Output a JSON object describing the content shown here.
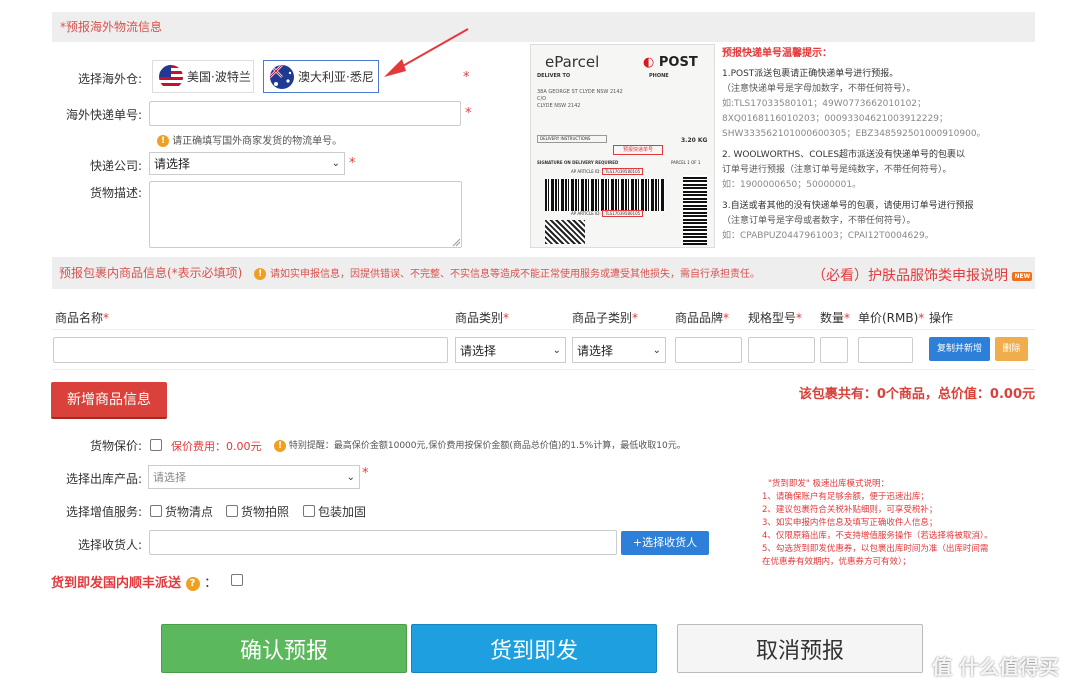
{
  "logistics": {
    "section_title": "*预报海外物流信息",
    "warehouse_label": "选择海外仓:",
    "warehouse_options": [
      {
        "label": "美国·波特兰"
      },
      {
        "label": "澳大利亚·悉尼"
      }
    ],
    "tracking_label": "海外快递单号:",
    "tracking_value": "",
    "tracking_hint": "请正确填写国外商家发货的物流单号。",
    "courier_label": "快递公司:",
    "courier_value": "请选择",
    "desc_label": "货物描述:",
    "desc_value": "",
    "required_mark": "*"
  },
  "parcel_image": {
    "brand": "eParcel",
    "carrier": "POST",
    "deliver_to": "DELIVER TO",
    "phone": "PHONE",
    "address_lines": [
      "38A GEORGE ST CLYDE NSW 2142",
      "C/O",
      "CLYDE NSW 2142"
    ],
    "delivery_instructions": "DELIVERY INSTRUCTIONS",
    "weight": "3.20 KG",
    "signature": "SIGNATURE ON DELIVERY REQUIRED",
    "parcel": "PARCEL 1 OF 1",
    "article_id_label": "AP ARTICLE ID:",
    "article_id": "TLS17039580105",
    "annotation": "预报快递单号"
  },
  "tracking_tips": {
    "title": "预报快递单号温馨提示：",
    "lines": [
      "1.POST派送包裹请正确快递单号进行预报。",
      "（注意快递单号是字母加数字，不带任何符号）。",
      "如:TLS17033580101；49W0773662010102；",
      "8XQ0168116010203；00093304621003912229；",
      "SHW333562101000600305；EBZ348592501000910900。",
      "2. WOOLWORTHS、COLES超市派送没有快递单号的包裹以",
      "订单号进行预报（注意订单号是纯数字，不带任何符号）。",
      "如：1900000650；50000001。",
      "3.自送或者其他的没有快递单号的包裹，请使用订单号进行预报",
      "（注意订单号是字母或者数字，不带任何符号）。",
      "如：CPABPUZ0447961003；CPAI12T0004629。"
    ]
  },
  "goods": {
    "section_title": "预报包裹内商品信息(*表示必填项)",
    "warning": "请如实申报信息，因提供错误、不完整、不实信息等造成不能正常使用服务或遭受其他损失，需自行承担责任。",
    "notice_link": "（必看）护肤品服饰类申报说明",
    "new_badge": "NEW",
    "columns": {
      "name": "商品名称",
      "category": "商品类别",
      "subcategory": "商品子类别",
      "brand": "商品品牌",
      "spec": "规格型号",
      "qty": "数量",
      "price": "单价(RMB)",
      "action": "操作"
    },
    "row": {
      "category_value": "请选择",
      "subcategory_value": "请选择",
      "copy_button": "复制并新增",
      "delete_button": "删除"
    },
    "add_button": "新增商品信息",
    "summary": "该包裹共有：0个商品，总价值：0.00元"
  },
  "options": {
    "insurance_label": "货物保价:",
    "insurance_fee": "保价费用：0.00元",
    "insurance_tip": "特别提醒：最高保价金额10000元,保价费用按保价金额(商品总价值)的1.5%计算，最低收取10元。",
    "outbound_label": "选择出库产品:",
    "outbound_value": "请选择",
    "value_added_label": "选择增值服务:",
    "services": [
      "货物清点",
      "货物拍照",
      "包装加固"
    ],
    "receiver_label": "选择收货人:",
    "receiver_value": "",
    "receiver_button": "+选择收货人",
    "sf_label": "货到即发国内顺丰派送",
    "sf_colon": "："
  },
  "instant_note": {
    "title": "\"货到即发\" 极速出库模式说明：",
    "lines": [
      "1、请确保账户有足够余额，便于迅速出库；",
      "2、建议包裹符合关税补贴细则，可享受税补；",
      "3、如实申报内件信息及填写正确收件人信息；",
      "4、仅限原箱出库，不支持增值服务操作（若选择将被取消）。",
      "5、勾选货到即发优惠券，以包裹出库时间为准（出库时间需",
      "在优惠券有效期内，优惠券方可有效）；"
    ]
  },
  "actions": {
    "confirm": "确认预报",
    "instant": "货到即发",
    "cancel": "取消预报"
  },
  "watermark": {
    "text": "值 什么值得买"
  },
  "colors": {
    "green": "#5cb85c",
    "blue": "#1e9fe0",
    "red": "#d9534f",
    "orange": "#f0ad4e",
    "link_blue": "#2d7fd8"
  }
}
